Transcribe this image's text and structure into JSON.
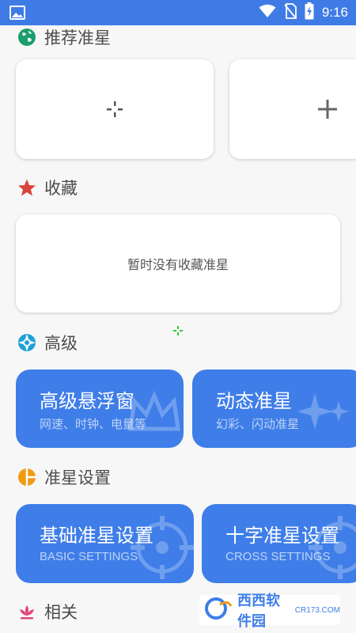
{
  "status_bar": {
    "time": "9:16",
    "icons": [
      "image-icon",
      "wifi-icon",
      "no-sim-icon",
      "battery-charging-icon"
    ]
  },
  "sections": {
    "recommended": {
      "title": "推荐准星",
      "icon": "globe-icon",
      "color": "#1a9e6b"
    },
    "favorites": {
      "title": "收藏",
      "icon": "star-icon",
      "color": "#d9443c",
      "empty_text": "暂时没有收藏准星"
    },
    "advanced": {
      "title": "高级",
      "icon": "lifebuoy-icon",
      "color": "#1fa0d9"
    },
    "crosshair_settings": {
      "title": "准星设置",
      "icon": "pie-icon",
      "color": "#f29a12"
    },
    "related": {
      "title": "相关",
      "icon": "lotus-icon",
      "color": "#e0457a"
    }
  },
  "recommended_cards": [
    {
      "icon": "crosshair-small-icon"
    },
    {
      "icon": "plus-icon"
    }
  ],
  "advanced_cards": [
    {
      "title": "高级悬浮窗",
      "subtitle": "网速、时钟、电量等",
      "icon": "crown-icon"
    },
    {
      "title": "动态准星",
      "subtitle": "幻彩、闪动准星",
      "icon": "sparkle-icon"
    }
  ],
  "settings_cards": [
    {
      "title": "基础准星设置",
      "subtitle": "BASIC SETTINGS",
      "icon": "target-icon"
    },
    {
      "title": "十字准星设置",
      "subtitle": "CROSS SETTINGS",
      "icon": "target-icon"
    }
  ],
  "watermark": {
    "brand": "西西软件园",
    "site": "CR173.COM"
  },
  "colors": {
    "status_bar": "#3f7be5",
    "card_blue": "#3f7ee8",
    "background": "#f7f7f7"
  }
}
